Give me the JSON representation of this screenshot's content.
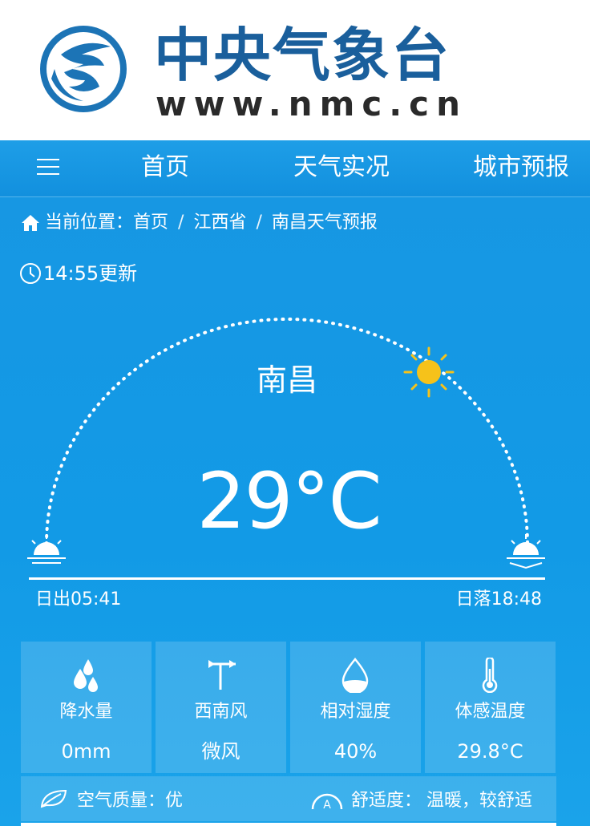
{
  "header": {
    "brand_title": "中央气象台",
    "brand_url": "www.nmc.cn"
  },
  "nav": {
    "items": [
      "首页",
      "天气实况",
      "城市预报"
    ]
  },
  "breadcrumb": {
    "prefix": "当前位置：",
    "items": [
      "首页",
      "江西省",
      "南昌天气预报"
    ],
    "separator": "/"
  },
  "update": {
    "text": "14:55更新"
  },
  "weather": {
    "city": "南昌",
    "temperature": "29°C",
    "sunrise": "日出05:41",
    "sunset": "日落18:48"
  },
  "cards": [
    {
      "icon": "raindrops-icon",
      "label": "降水量",
      "value": "0mm"
    },
    {
      "icon": "wind-vane-icon",
      "label": "西南风",
      "value": "微风"
    },
    {
      "icon": "humidity-drop-icon",
      "label": "相对湿度",
      "value": "40%"
    },
    {
      "icon": "thermometer-icon",
      "label": "体感温度",
      "value": "29.8°C"
    }
  ],
  "bottom": {
    "air_quality_label": "空气质量：优",
    "comfort_label": "舒适度：",
    "comfort_value": "温暖，较舒适"
  },
  "colors": {
    "brand_blue": "#1a5f9c",
    "nav_blue": "#1290de",
    "sky_blue": "#129ae6",
    "sun_yellow": "#f6c21a"
  }
}
